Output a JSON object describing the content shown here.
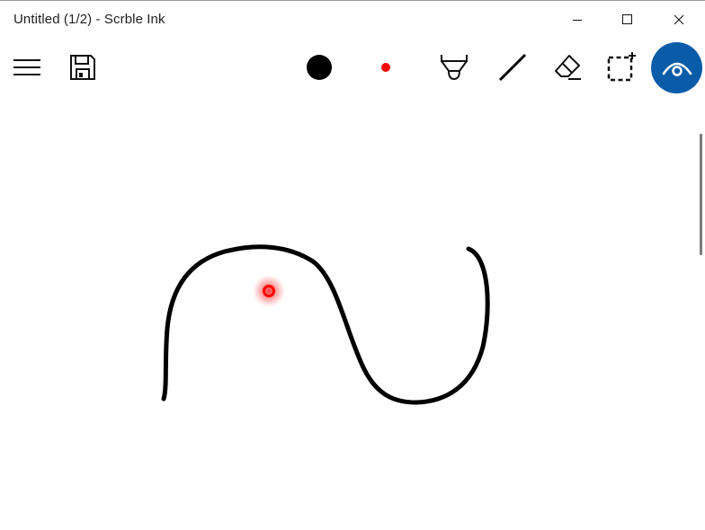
{
  "window": {
    "title": "Untitled (1/2) - Scrble Ink"
  },
  "window_controls": {
    "minimize_icon": "minimize-icon",
    "maximize_icon": "maximize-icon",
    "close_icon": "close-icon"
  },
  "toolbar": {
    "menu_icon": "hamburger-menu-icon",
    "save_icon": "floppy-disk-icon",
    "pen_size_icon": "filled-circle-icon",
    "pen_color_icon": "color-dot-icon",
    "highlighter_icon": "highlighter-icon",
    "line_icon": "line-icon",
    "eraser_icon": "eraser-icon",
    "select_icon": "selection-icon",
    "view_icon": "eye-icon"
  },
  "colors": {
    "ink": "#000000",
    "pen_color": "#ff0000",
    "accent": "#0a5ca8",
    "pointer_glow": "#ff3b3b"
  }
}
